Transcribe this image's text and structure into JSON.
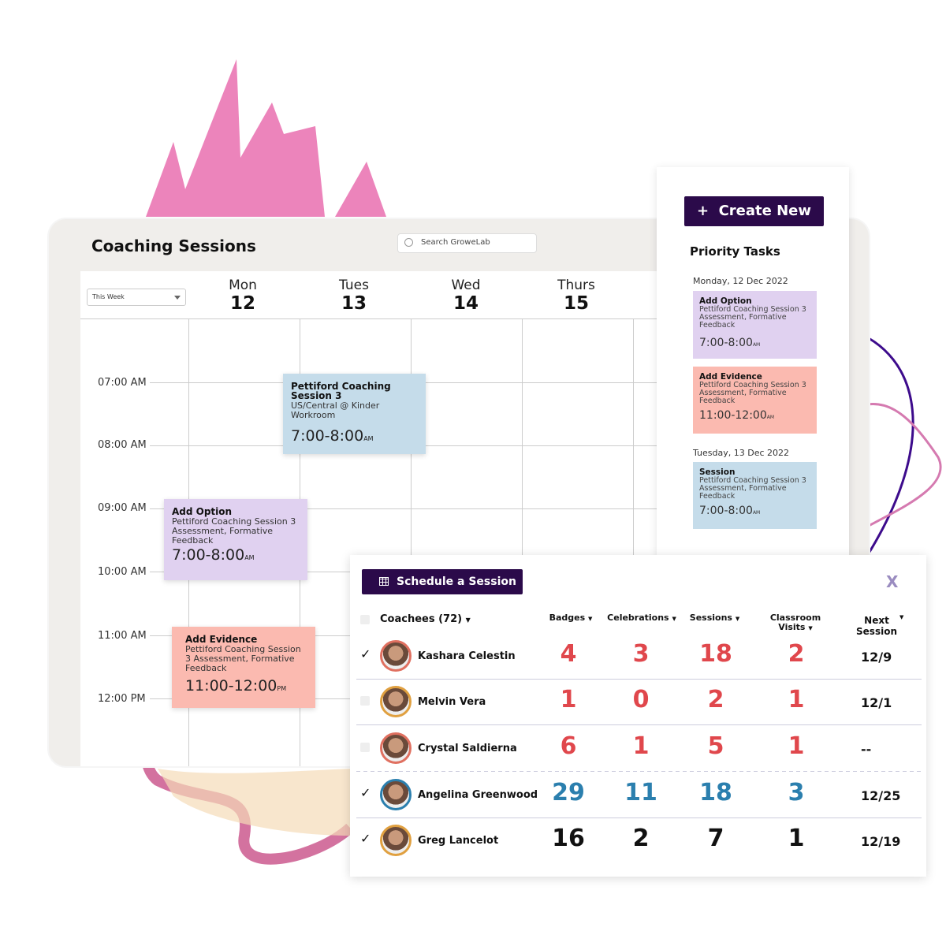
{
  "calendar": {
    "title": "Coaching Sessions",
    "search_placeholder": "Search GroweLab",
    "range_select": "This Week",
    "days": [
      {
        "name": "Mon",
        "date": "12"
      },
      {
        "name": "Tues",
        "date": "13"
      },
      {
        "name": "Wed",
        "date": "14"
      },
      {
        "name": "Thurs",
        "date": "15"
      }
    ],
    "times": [
      "07:00 AM",
      "08:00 AM",
      "09:00 AM",
      "10:00 AM",
      "11:00 AM",
      "12:00 PM"
    ],
    "events": [
      {
        "title": "Pettiford Coaching Session 3",
        "body": "US/Central @ Kinder Workroom",
        "time": "7:00-8:00",
        "ampm": "AM"
      },
      {
        "title": "Add Option",
        "body": "Pettiford Coaching Session 3 Assessment, Formative Feedback",
        "time": "7:00-8:00",
        "ampm": "AM"
      },
      {
        "title": "Add Evidence",
        "body": "Pettiford Coaching Session 3 Assessment, Formative Feedback",
        "time": "11:00-12:00",
        "ampm": "PM"
      }
    ]
  },
  "priority": {
    "create_label": "Create New",
    "title": "Priority Tasks",
    "groups": [
      {
        "date": "Monday, 12 Dec 2022"
      },
      {
        "date": "Tuesday, 13 Dec 2022"
      }
    ],
    "cards": [
      {
        "title": "Add Option",
        "body": "Pettiford Coaching Session 3 Assessment, Formative Feedback",
        "time": "7:00-8:00",
        "ampm": "AM"
      },
      {
        "title": "Add Evidence",
        "body": "Pettiford Coaching Session 3 Assessment, Formative Feedback",
        "time": "11:00-12:00",
        "ampm": "AM"
      },
      {
        "title": "Session",
        "body": "Pettiford Coaching Session 3 Assessment, Formative Feedback",
        "time": "7:00-8:00",
        "ampm": "AM"
      }
    ]
  },
  "schedule": {
    "button": "Schedule a Session",
    "close": "X",
    "headers": {
      "coachees": "Coachees (72)",
      "badges": "Badges",
      "celebrations": "Celebrations",
      "sessions": "Sessions",
      "classroom": "Classroom Visits",
      "next": "Next Session"
    },
    "rows": [
      {
        "name": "Kashara Celestin",
        "checked": true,
        "badges": "4",
        "celebrations": "3",
        "sessions": "18",
        "visits": "2",
        "next": "12/9",
        "color": "#e0474c"
      },
      {
        "name": "Melvin Vera",
        "checked": false,
        "badges": "1",
        "celebrations": "0",
        "sessions": "2",
        "visits": "1",
        "next": "12/1",
        "color": "#e0474c"
      },
      {
        "name": "Crystal Saldierna",
        "checked": false,
        "badges": "6",
        "celebrations": "1",
        "sessions": "5",
        "visits": "1",
        "next": "--",
        "color": "#e0474c"
      },
      {
        "name": "Angelina Greenwood",
        "checked": true,
        "badges": "29",
        "celebrations": "11",
        "sessions": "18",
        "visits": "3",
        "next": "12/25",
        "color": "#2b7fae"
      },
      {
        "name": "Greg Lancelot",
        "checked": true,
        "badges": "16",
        "celebrations": "2",
        "sessions": "7",
        "visits": "1",
        "next": "12/19",
        "color": "#111111"
      }
    ]
  },
  "colors": {
    "accent": "#2b0a4a",
    "event_blue": "#c5dcea",
    "event_purple": "#e0d1f0",
    "event_salmon": "#fbbab0"
  }
}
